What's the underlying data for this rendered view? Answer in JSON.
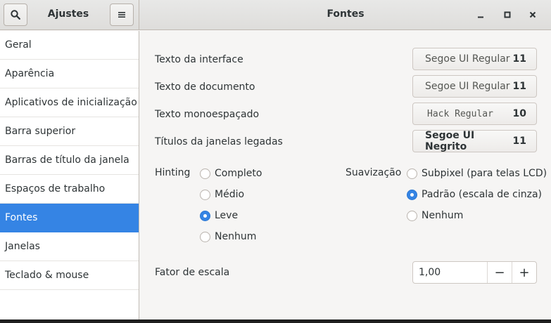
{
  "header": {
    "app_title": "Ajustes",
    "page_title": "Fontes"
  },
  "sidebar": {
    "items": [
      {
        "label": "Geral"
      },
      {
        "label": "Aparência"
      },
      {
        "label": "Aplicativos de inicialização"
      },
      {
        "label": "Barra superior"
      },
      {
        "label": "Barras de título da janela"
      },
      {
        "label": "Espaços de trabalho"
      },
      {
        "label": "Fontes",
        "active": true
      },
      {
        "label": "Janelas"
      },
      {
        "label": "Teclado & mouse"
      }
    ]
  },
  "fonts": {
    "interface": {
      "label": "Texto da interface",
      "font": "Segoe UI Regular",
      "size": "11"
    },
    "document": {
      "label": "Texto de documento",
      "font": "Segoe UI Regular",
      "size": "11"
    },
    "monospace": {
      "label": "Texto monoespaçado",
      "font": "Hack Regular",
      "size": "10"
    },
    "legacy_titles": {
      "label": "Títulos da janelas legadas",
      "font": "Segoe UI Negrito",
      "size": "11"
    }
  },
  "hinting": {
    "label": "Hinting",
    "options": [
      "Completo",
      "Médio",
      "Leve",
      "Nenhum"
    ],
    "selected": "Leve"
  },
  "antialiasing": {
    "label": "Suavização",
    "options": [
      "Subpixel (para telas LCD)",
      "Padrão (escala de cinza)",
      "Nenhum"
    ],
    "selected": "Padrão (escala de cinza)"
  },
  "scaling": {
    "label": "Fator de escala",
    "value": "1,00",
    "decrement": "−",
    "increment": "+"
  },
  "icons": {
    "search": "search-icon",
    "menu": "hamburger-menu-icon",
    "minimize": "minimize-icon",
    "maximize": "maximize-icon",
    "close": "close-icon"
  },
  "colors": {
    "accent": "#3584e4",
    "sidebar_bg": "#ffffff",
    "content_bg": "#f6f5f4"
  }
}
